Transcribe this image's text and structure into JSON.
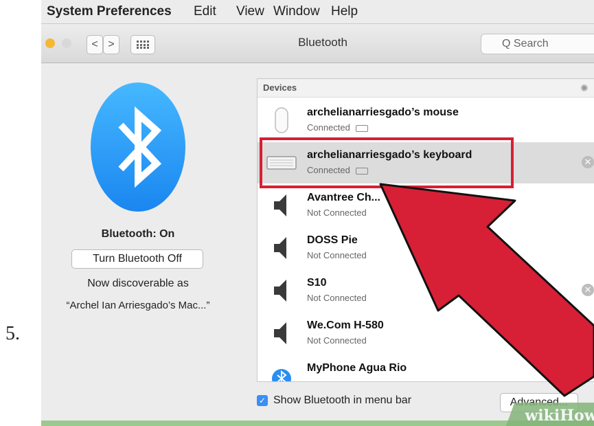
{
  "step_number": "5.",
  "menubar": {
    "items": [
      "System Preferences",
      "Edit",
      "View",
      "Window",
      "Help"
    ]
  },
  "toolbar": {
    "back_icon": "chevron-left-icon",
    "forward_icon": "chevron-right-icon",
    "grid_icon": "grid-icon",
    "title": "Bluetooth",
    "search_placeholder": "Q Search"
  },
  "left_panel": {
    "status": "Bluetooth: On",
    "toggle_button": "Turn Bluetooth Off",
    "discoverable_label": "Now discoverable as",
    "discoverable_name": "“Archel Ian Arriesgado’s Mac...”"
  },
  "devices": {
    "header": "Devices",
    "items": [
      {
        "name": "archelianarriesgado’s mouse",
        "status": "Connected",
        "icon": "mouse-icon",
        "battery": true
      },
      {
        "name": "archelianarriesgado’s keyboard",
        "status": "Connected",
        "icon": "keyboard-icon",
        "battery": true
      },
      {
        "name": "Avantree Ch...",
        "status": "Not Connected",
        "icon": "speaker-icon"
      },
      {
        "name": "DOSS Pie",
        "status": "Not Connected",
        "icon": "speaker-icon"
      },
      {
        "name": "S10",
        "status": "Not Connected",
        "icon": "speaker-icon"
      },
      {
        "name": "We.Com H-580",
        "status": "Not Connected",
        "icon": "speaker-icon"
      },
      {
        "name": "MyPhone Agua Rio",
        "status": "",
        "icon": "bluetooth-device-icon"
      }
    ]
  },
  "bottom": {
    "checkbox_label": "Show Bluetooth in menu bar",
    "checked": true,
    "advanced_button": "Advanced..."
  },
  "watermark": "wikiHow",
  "colors": {
    "highlight": "#d71f33",
    "bluetooth_blue": "#1a86f0",
    "frame_green": "#9cc98f"
  }
}
